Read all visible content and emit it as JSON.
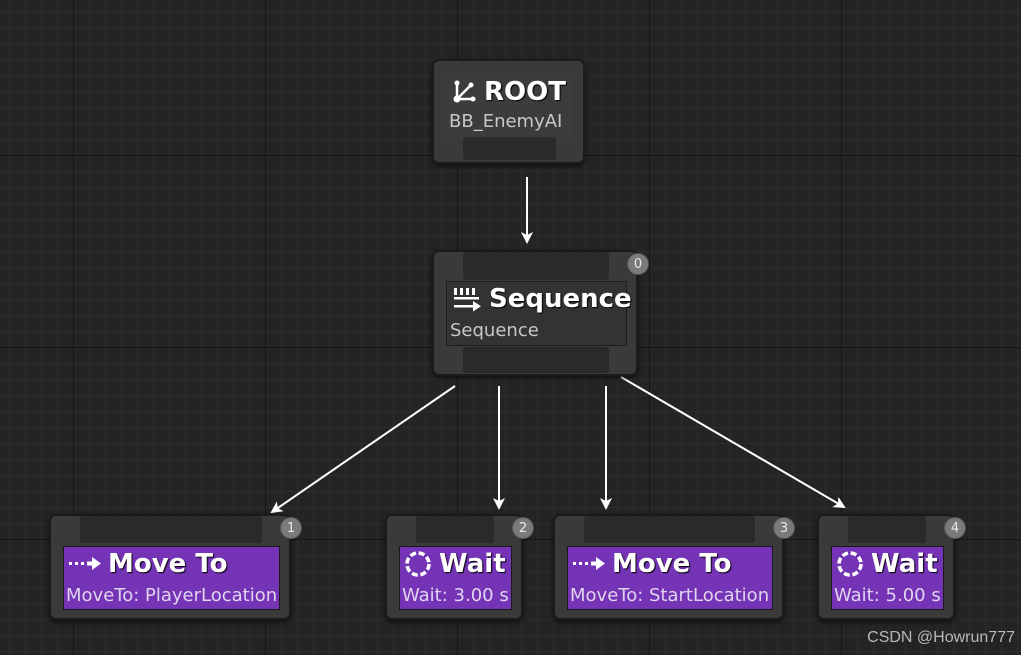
{
  "root_node": {
    "title": "ROOT",
    "subtitle": "BB_EnemyAI",
    "icon": "branch-icon"
  },
  "sequence_node": {
    "title": "Sequence",
    "subtitle": "Sequence",
    "icon": "sequence-icon",
    "index": "0"
  },
  "tasks": [
    {
      "title": "Move To",
      "subtitle": "MoveTo: PlayerLocation",
      "icon": "move-to-icon",
      "index": "1"
    },
    {
      "title": "Wait",
      "subtitle": "Wait: 3.00 s",
      "icon": "wait-icon",
      "index": "2"
    },
    {
      "title": "Move To",
      "subtitle": "MoveTo: StartLocation",
      "icon": "move-to-icon",
      "index": "3"
    },
    {
      "title": "Wait",
      "subtitle": "Wait: 5.00 s",
      "icon": "wait-icon",
      "index": "4"
    }
  ],
  "colors": {
    "task": "#7533b6",
    "background": "#242424",
    "wire": "#ffffff"
  },
  "watermark": "CSDN @Howrun777"
}
